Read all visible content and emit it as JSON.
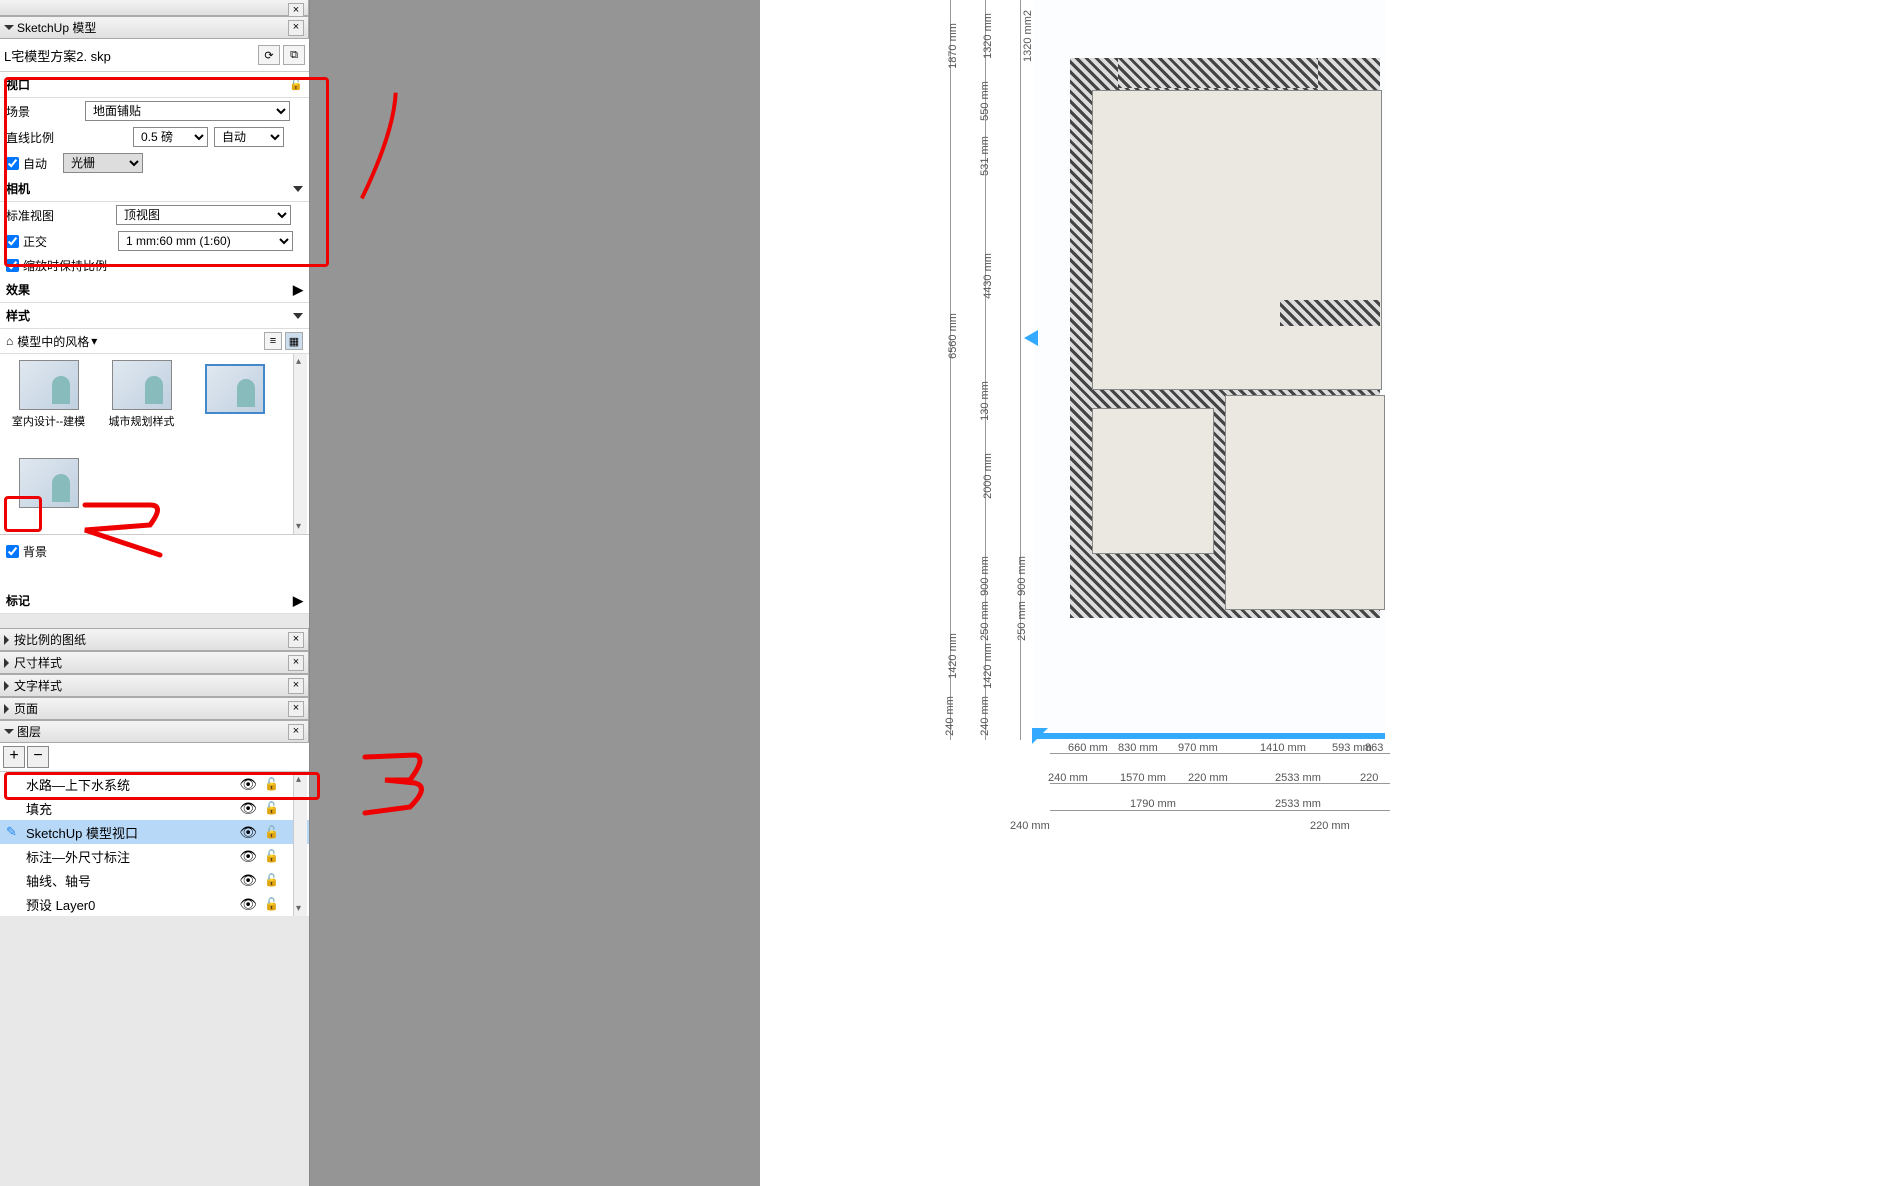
{
  "panels": {
    "sketchup_model": "SketchUp 模型",
    "scaled_drawing": "按比例的图纸",
    "dim_style": "尺寸样式",
    "text_style": "文字样式",
    "page": "页面",
    "layers": "图层"
  },
  "file": "L宅模型方案2. skp",
  "viewport": {
    "title": "视口",
    "scene_label": "场景",
    "scene_value": "地面铺贴",
    "line_scale_label": "直线比例",
    "line_scale_value": "0.5 磅",
    "line_scale_mode": "自动",
    "auto_label": "自动",
    "raster_label": "光栅"
  },
  "camera": {
    "title": "相机",
    "std_view_label": "标准视图",
    "std_view_value": "顶视图",
    "ortho_label": "正交",
    "scale_value": "1 mm:60 mm (1:60)",
    "preserve_label": "缩放时保持比例"
  },
  "effect": "效果",
  "style": "样式",
  "style_browser": "模型中的风格",
  "styles": [
    "室内设计--建模",
    "城市规划样式"
  ],
  "background_label": "背景",
  "tags_label": "标记",
  "layers": [
    {
      "name": "水路—上下水系统",
      "sel": false
    },
    {
      "name": "填充",
      "sel": false
    },
    {
      "name": "SketchUp 模型视口",
      "sel": true
    },
    {
      "name": "标注—外尺寸标注",
      "sel": false
    },
    {
      "name": "轴线、轴号",
      "sel": false
    },
    {
      "name": "预设 Layer0",
      "sel": false
    }
  ],
  "dims": {
    "v_col1": [
      "1870 mm",
      "6560 mm",
      "1420 mm",
      "240 mm"
    ],
    "v_col2": [
      "1320 mm",
      "550 mm",
      "531 mm",
      "4430 mm",
      "130 mm",
      "2000 mm",
      "900 mm",
      "250 mm",
      "1420 mm",
      "240 mm"
    ],
    "v_col3": [
      "1320 mm2",
      "900 mm",
      "250 mm"
    ],
    "h_row1": [
      "660 mm",
      "830 mm",
      "970 mm",
      "1410 mm",
      "593 mm",
      "863"
    ],
    "h_row2": [
      "240 mm",
      "1570 mm",
      "220 mm",
      "2533 mm",
      "220"
    ],
    "h_row3": [
      "1790 mm",
      "2533 mm"
    ],
    "h_row4": [
      "240 mm",
      "220 mm"
    ]
  },
  "annotations": {
    "a1": "1",
    "a2": "2",
    "a3": "3"
  }
}
